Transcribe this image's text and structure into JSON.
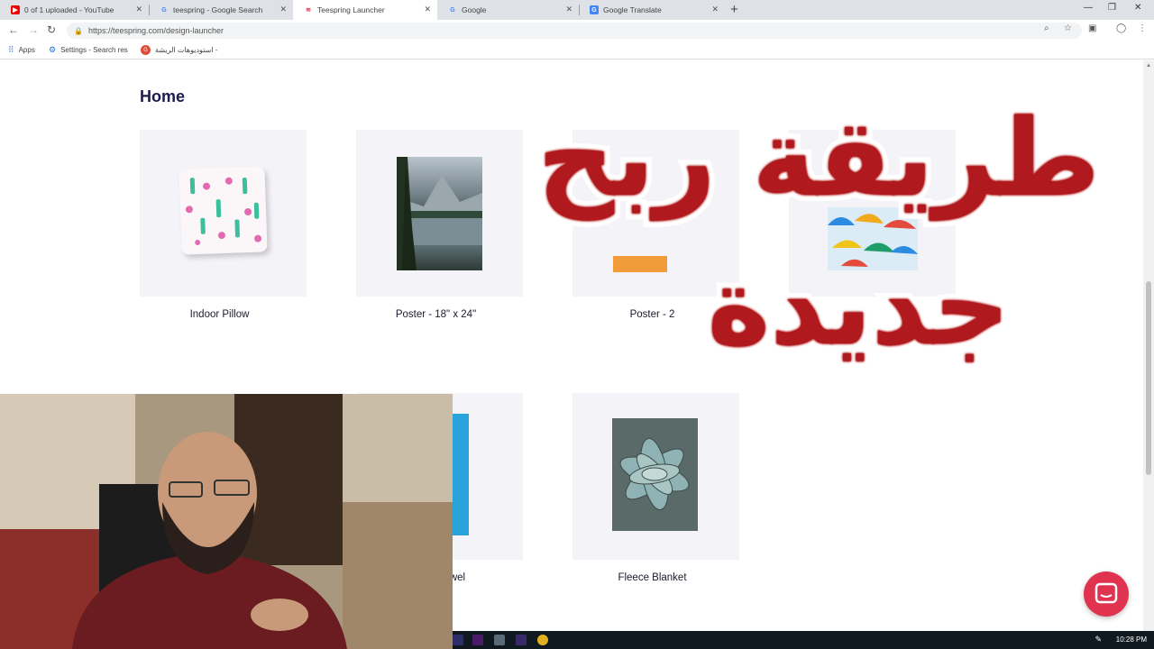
{
  "browser": {
    "tabs": [
      {
        "title": "0 of 1 uploaded - YouTube",
        "icon": "youtube-icon",
        "active": false
      },
      {
        "title": "teespring - Google Search",
        "icon": "google-icon",
        "active": false
      },
      {
        "title": "Teespring Launcher",
        "icon": "teespring-icon",
        "active": true
      },
      {
        "title": "Google",
        "icon": "google-icon",
        "active": false
      },
      {
        "title": "Google Translate",
        "icon": "translate-icon",
        "active": false
      }
    ],
    "url": "https://teespring.com/design-launcher",
    "bookmarks": [
      {
        "label": "Apps",
        "icon": "apps-grid-icon"
      },
      {
        "label": "Settings - Search res",
        "icon": "gear-icon"
      },
      {
        "label": "استوديوهات الريشة -",
        "icon": "google-plus-icon"
      }
    ]
  },
  "page": {
    "section_title": "Home",
    "products": [
      {
        "label": "Indoor Pillow"
      },
      {
        "label": "Poster - 18\" x 24\""
      },
      {
        "label": "Poster - 2"
      },
      {
        "label": ""
      },
      {
        "label": "wel"
      },
      {
        "label": "Fleece Blanket"
      }
    ]
  },
  "overlay": {
    "line1": "طريقة ربح",
    "line2": "جديدة"
  },
  "taskbar": {
    "time": "10:28 PM"
  },
  "colors": {
    "accent_title": "#1e1b4b",
    "overlay_text": "#b01a1f",
    "chat_button": "#e03350"
  }
}
